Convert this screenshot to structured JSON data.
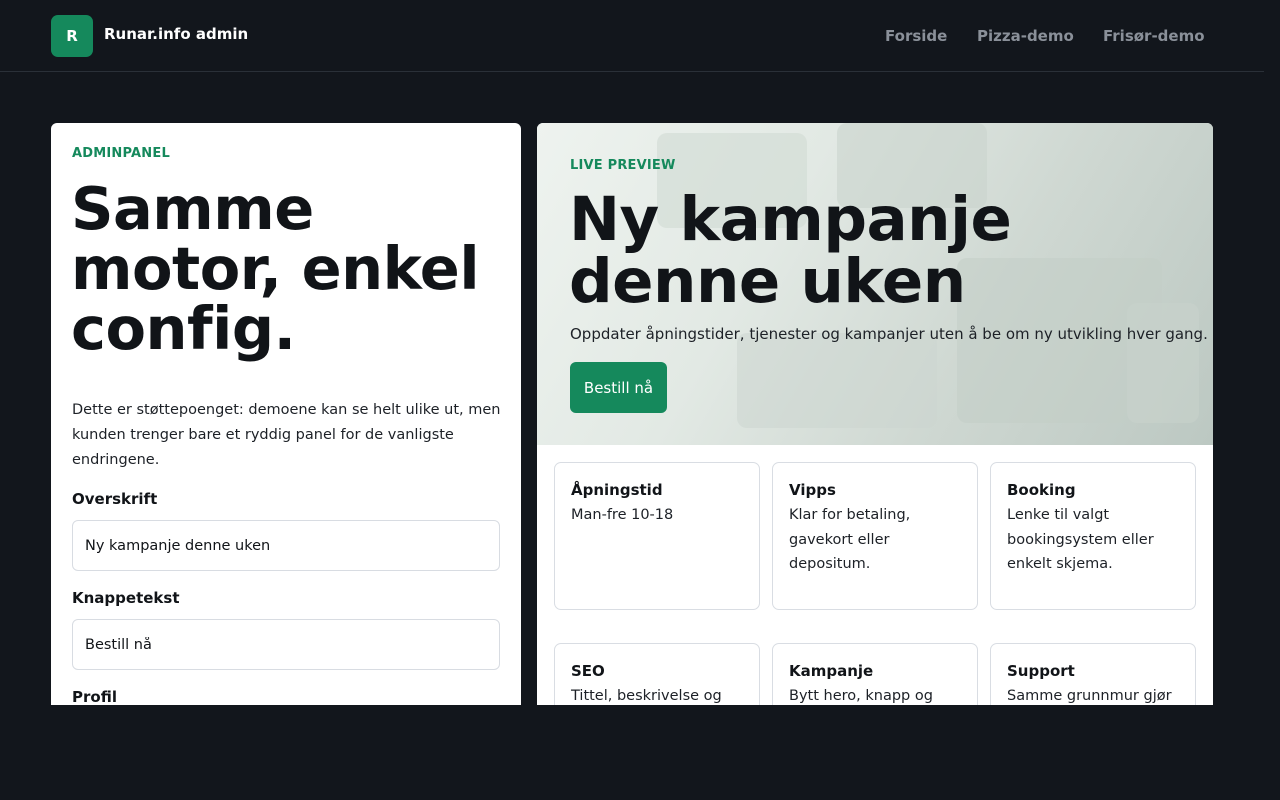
{
  "header": {
    "logo_letter": "R",
    "brand": "Runar.info admin",
    "nav": [
      "Forside",
      "Pizza-demo",
      "Frisør-demo"
    ]
  },
  "admin": {
    "eyebrow": "ADMINPANEL",
    "title": "Samme motor, enkel config.",
    "intro": "Dette er støttepoenget: demoene kan se helt ulike ut, men kunden trenger bare et ryddig panel for de vanligste endringene.",
    "fields": [
      {
        "label": "Overskrift",
        "value": "Ny kampanje denne uken"
      },
      {
        "label": "Knappetekst",
        "value": "Bestill nå"
      },
      {
        "label": "Profil"
      }
    ]
  },
  "preview": {
    "eyebrow": "LIVE PREVIEW",
    "title": "Ny kampanje denne uken",
    "description": "Oppdater åpningstider, tjenester og kampanjer uten å be om ny utvikling hver gang.",
    "button": "Bestill nå",
    "cards": [
      {
        "title": "Åpningstid",
        "text": "Man-fre 10-18"
      },
      {
        "title": "Vipps",
        "text": "Klar for betaling, gavekort eller depositum."
      },
      {
        "title": "Booking",
        "text": "Lenke til valgt bookingsystem eller enkelt skjema."
      },
      {
        "title": "SEO",
        "text": "Tittel, beskrivelse og"
      },
      {
        "title": "Kampanje",
        "text": "Bytt hero, knapp og"
      },
      {
        "title": "Support",
        "text": "Samme grunnmur gjør"
      }
    ]
  },
  "colors": {
    "background": "#12161c",
    "accent": "#15895c",
    "panel": "#ffffff"
  }
}
